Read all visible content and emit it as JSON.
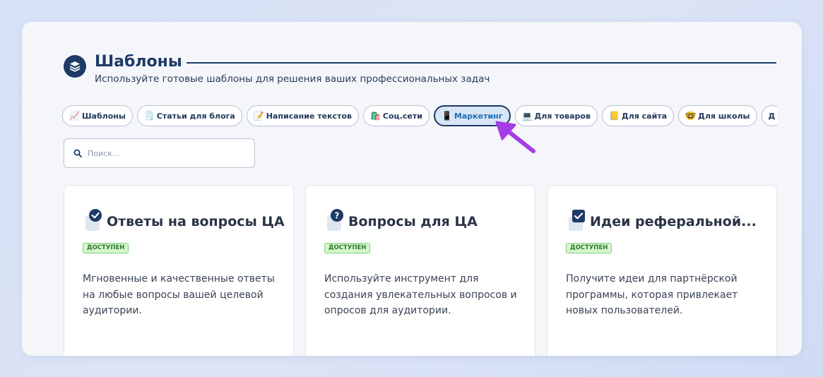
{
  "header": {
    "title": "Шаблоны",
    "subtitle": "Используйте готовые шаблоны для решения ваших профессиональных задач"
  },
  "tabs": [
    {
      "icon": "📈",
      "label": "Шаблоны",
      "active": false
    },
    {
      "icon": "🗒️",
      "label": "Статьи для блога",
      "active": false
    },
    {
      "icon": "📝",
      "label": "Написание текстов",
      "active": false
    },
    {
      "icon": "🛍️",
      "label": "Соц.сети",
      "active": false
    },
    {
      "icon": "📱",
      "label": "Маркетинг",
      "active": true
    },
    {
      "icon": "💻",
      "label": "Для товаров",
      "active": false
    },
    {
      "icon": "📒",
      "label": "Для сайта",
      "active": false
    },
    {
      "icon": "🤓",
      "label": "Для школы",
      "active": false
    },
    {
      "icon": "",
      "label": "Д",
      "active": false
    }
  ],
  "search": {
    "placeholder": "Поиск...",
    "value": ""
  },
  "cards": [
    {
      "icon": "check-circle-icon",
      "title": "Ответы на вопросы ЦА",
      "badge": "ДОСТУПЕН",
      "description": "Мгновенные и качественные ответы на любые вопросы вашей целевой аудитории."
    },
    {
      "icon": "question-circle-icon",
      "title": "Вопросы для ЦА",
      "badge": "ДОСТУПЕН",
      "description": "Используйте инструмент для создания увлекательных вопросов и опросов для аудитории."
    },
    {
      "icon": "check-box-icon",
      "title": "Идеи реферальной...",
      "badge": "ДОСТУПЕН",
      "description": "Получите идеи для партнёрской программы, которая привлекает новых пользователей."
    }
  ],
  "colors": {
    "brand": "#1e3a66",
    "accent": "#1e6fb8",
    "badge_bg": "#d6f4cf",
    "arrow": "#a63ce6"
  }
}
